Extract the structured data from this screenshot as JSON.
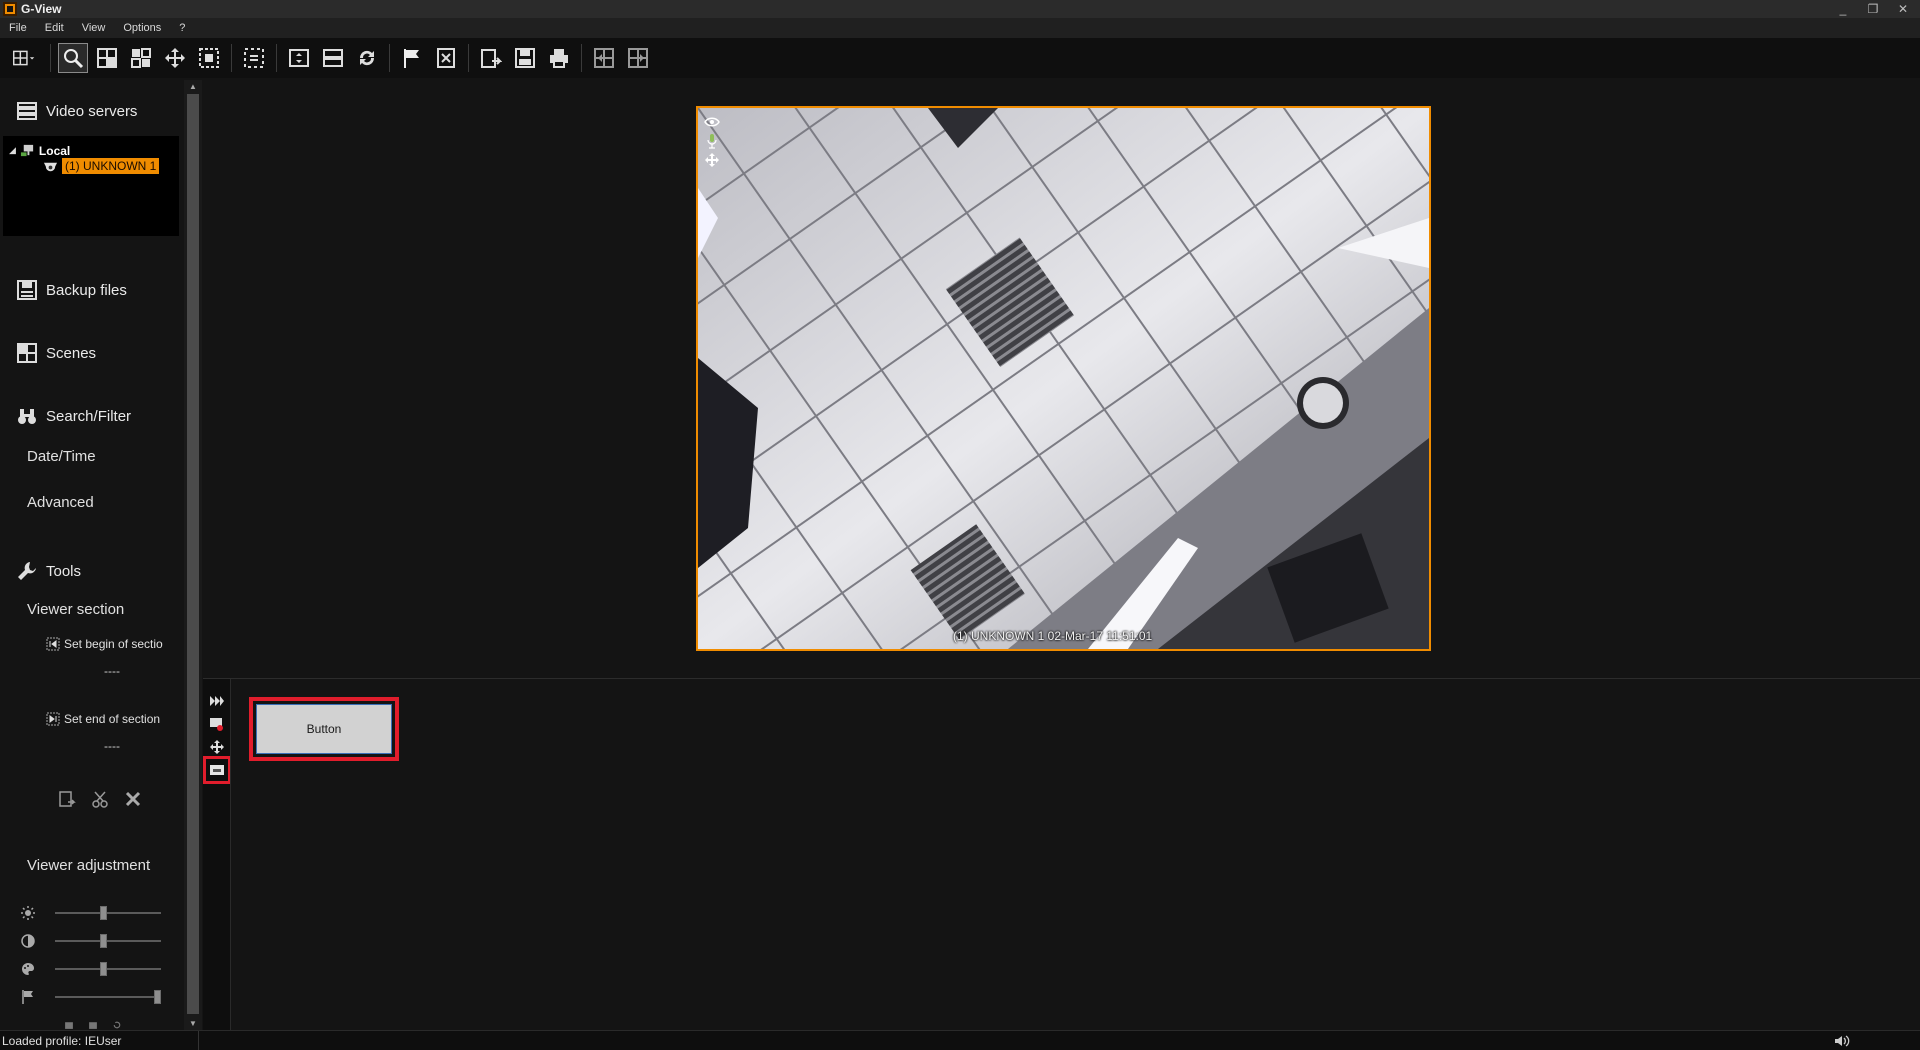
{
  "window": {
    "title": "G-View",
    "controls": [
      "_",
      "❐",
      "✕"
    ]
  },
  "menu": {
    "items": [
      "File",
      "Edit",
      "View",
      "Options",
      "?"
    ]
  },
  "sidebar": {
    "video_servers": {
      "label": "Video servers",
      "tree": {
        "root": "Local",
        "selected": "(1) UNKNOWN 1"
      }
    },
    "backup_files": "Backup files",
    "scenes": "Scenes",
    "search_filter": {
      "label": "Search/Filter",
      "date_time": "Date/Time",
      "advanced": "Advanced"
    },
    "tools": {
      "label": "Tools",
      "viewer_section": "Viewer section",
      "set_begin": "Set begin of sectio",
      "begin_value": "----",
      "set_end": "Set end of section",
      "end_value": "----"
    },
    "viewer_adjustment": {
      "label": "Viewer adjustment",
      "brightness": 0.45,
      "contrast": 0.45,
      "color": 0.45,
      "marker": 1.0
    }
  },
  "video": {
    "caption": "(1) UNKNOWN 1  02-Mar-17 11:51:01"
  },
  "bottom_panel": {
    "button_label": "Button"
  },
  "status": {
    "text": "Loaded profile: IEUser"
  },
  "colors": {
    "accent": "#f08c00",
    "highlight": "#e11d2c",
    "background": "#141414"
  }
}
